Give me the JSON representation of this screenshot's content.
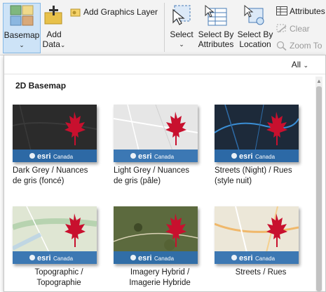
{
  "ribbon": {
    "basemap_label": "Basemap",
    "add_data_label": "Add",
    "add_data_label2": "Data",
    "add_graphics_layer_label": "Add Graphics Layer",
    "select_label": "Select",
    "select_by_attributes_label": "Select By",
    "select_by_attributes_label2": "Attributes",
    "select_by_location_label": "Select By",
    "select_by_location_label2": "Location",
    "attributes_label": "Attributes",
    "clear_label": "Clear",
    "zoom_to_label": "Zoom To"
  },
  "gallery": {
    "filter": "All",
    "section_title": "2D Basemap",
    "watermark_brand": "esri",
    "watermark_region": "Canada",
    "tiles": [
      {
        "line1": "Dark Grey / Nuances",
        "line2": "de gris (foncé)",
        "bg": "#2b2b2b"
      },
      {
        "line1": "Light Grey / Nuances",
        "line2": "de gris (pâle)",
        "bg": "#e6e6e6"
      },
      {
        "line1": "Streets (Night) / Rues",
        "line2": "(style nuit)",
        "bg": "#1d2a3a"
      },
      {
        "line1": "Topographic /",
        "line2": "Topographie",
        "bg": "#dfe6d3"
      },
      {
        "line1": "Imagery Hybrid /",
        "line2": "Imagerie Hybride",
        "bg": "#4d5a35"
      },
      {
        "line1": "Streets / Rues",
        "line2": "",
        "bg": "#ece7d8"
      }
    ]
  },
  "colors": {
    "accent": "#1e73be",
    "leaf_red": "#c8102e",
    "banner_blue": "#2e6fb0"
  }
}
